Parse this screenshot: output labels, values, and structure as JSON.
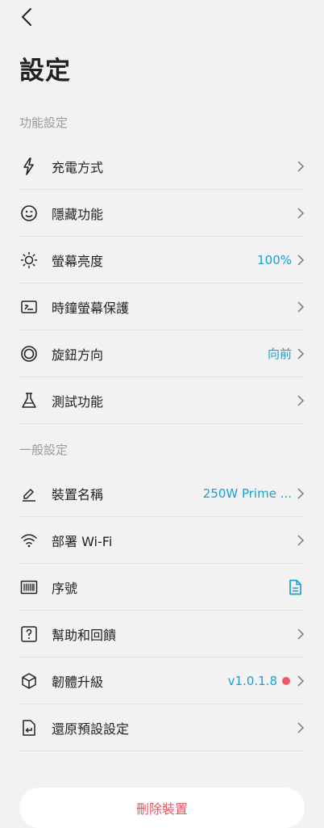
{
  "header": {
    "title": "設定"
  },
  "sections": [
    {
      "title": "功能設定",
      "items": [
        {
          "label": "充電方式",
          "value": "",
          "icon": "lightning-icon"
        },
        {
          "label": "隱藏功能",
          "value": "",
          "icon": "wink-face-icon"
        },
        {
          "label": "螢幕亮度",
          "value": "100%",
          "icon": "sun-icon"
        },
        {
          "label": "時鐘螢幕保護",
          "value": "",
          "icon": "screen-saver-icon"
        },
        {
          "label": "旋鈕方向",
          "value": "向前",
          "icon": "knob-icon"
        },
        {
          "label": "測試功能",
          "value": "",
          "icon": "flask-icon"
        }
      ]
    },
    {
      "title": "一般設定",
      "items": [
        {
          "label": "裝置名稱",
          "value": "250W Prime ...",
          "icon": "pencil-icon"
        },
        {
          "label": "部署 Wi-Fi",
          "value": "",
          "icon": "wifi-icon"
        },
        {
          "label": "序號",
          "value": "",
          "icon": "barcode-icon"
        },
        {
          "label": "幫助和回饋",
          "value": "",
          "icon": "help-icon"
        },
        {
          "label": "韌體升級",
          "value": "v1.0.1.8",
          "icon": "cube-icon"
        },
        {
          "label": "還原預設設定",
          "value": "",
          "icon": "restore-icon"
        }
      ]
    }
  ],
  "delete_button": "刪除裝置",
  "colors": {
    "accent": "#1aa0d8",
    "danger": "#e25563",
    "badge": "#ee5a67"
  }
}
